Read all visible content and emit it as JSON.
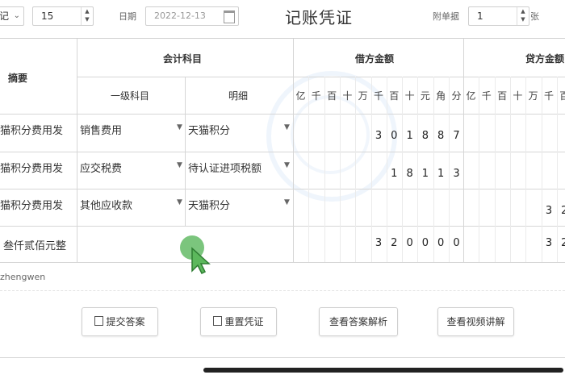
{
  "toolbar": {
    "selector_value": "记",
    "number_value": "15",
    "date_label": "日期",
    "date_value": "2022-12-13",
    "title": "记账凭证",
    "attachments_label": "附单据",
    "attachments_value": "1",
    "attachments_unit": "张"
  },
  "table": {
    "headers": {
      "summary": "摘要",
      "account": "会计科目",
      "first_level": "一级科目",
      "detail": "明细",
      "debit": "借方金额",
      "credit": "贷方金额"
    },
    "units": [
      "亿",
      "千",
      "百",
      "十",
      "万",
      "千",
      "百",
      "十",
      "元",
      "角",
      "分"
    ],
    "rows": [
      {
        "summary": "猫积分费用发",
        "account": "销售费用",
        "detail": "天猫积分",
        "debit": [
          "",
          "",
          "",
          "",
          "",
          "3",
          "0",
          "1",
          "8",
          "8",
          "7"
        ],
        "credit": [
          "",
          "",
          "",
          "",
          "",
          "",
          "",
          "",
          "",
          "",
          ""
        ]
      },
      {
        "summary": "猫积分费用发",
        "account": "应交税费",
        "detail": "待认证进项税额",
        "debit": [
          "",
          "",
          "",
          "",
          "",
          "",
          "1",
          "8",
          "1",
          "1",
          "3"
        ],
        "credit": [
          "",
          "",
          "",
          "",
          "",
          "",
          "",
          "",
          "",
          "",
          ""
        ]
      },
      {
        "summary": "猫积分费用发",
        "account": "其他应收款",
        "detail": "天猫积分",
        "debit": [
          "",
          "",
          "",
          "",
          "",
          "",
          "",
          "",
          "",
          "",
          ""
        ],
        "credit": [
          "",
          "",
          "",
          "",
          "",
          "3",
          "2",
          "",
          "",
          "",
          ""
        ]
      }
    ],
    "total": {
      "text": "叁仟贰佰元整",
      "debit": [
        "",
        "",
        "",
        "",
        "",
        "3",
        "2",
        "0",
        "0",
        "0",
        "0"
      ],
      "credit": [
        "",
        "",
        "",
        "",
        "",
        "3",
        "2",
        "",
        "",
        "",
        ""
      ]
    }
  },
  "user": "zhengwen",
  "buttons": {
    "submit": "提交答案",
    "reset": "重置凭证",
    "analysis": "查看答案解析",
    "video": "查看视频讲解"
  },
  "icons": {
    "dropdown": "dropdown-arrow-icon",
    "calendar": "calendar-icon",
    "cursor": "mouse-cursor-icon"
  },
  "colors": {
    "cursor": "#5cb85c",
    "grid": "#d6d6d6"
  }
}
